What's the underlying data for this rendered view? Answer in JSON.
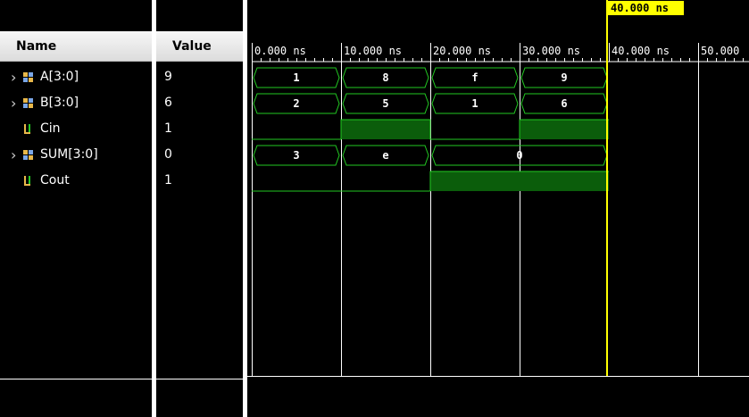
{
  "columns": {
    "name": "Name",
    "value": "Value"
  },
  "signals": [
    {
      "name": "A[3:0]",
      "value": "9",
      "type": "bus",
      "segments": [
        "1",
        "8",
        "f",
        "9"
      ],
      "icon": "bus-signal-icon"
    },
    {
      "name": "B[3:0]",
      "value": "6",
      "type": "bus",
      "segments": [
        "2",
        "5",
        "1",
        "6"
      ],
      "icon": "bus-signal-icon"
    },
    {
      "name": "Cin",
      "value": "1",
      "type": "bit",
      "levels": [
        0,
        1,
        0,
        1
      ],
      "icon": "bit-signal-icon"
    },
    {
      "name": "SUM[3:0]",
      "value": "0",
      "type": "bus",
      "segments": [
        "3",
        "e",
        "0",
        "0"
      ],
      "icon": "bus-signal-icon"
    },
    {
      "name": "Cout",
      "value": "1",
      "type": "bit",
      "levels": [
        0,
        0,
        1,
        1
      ],
      "icon": "bit-signal-icon"
    }
  ],
  "timeline": {
    "ticks": [
      "0.000 ns",
      "10.000 ns",
      "20.000 ns",
      "30.000 ns",
      "40.000 ns",
      "50.000"
    ],
    "cursor_label": "40.000 ns"
  },
  "colors": {
    "wave": "#22c922",
    "fill": "#0b5d0b",
    "cursor": "#ffff00"
  }
}
